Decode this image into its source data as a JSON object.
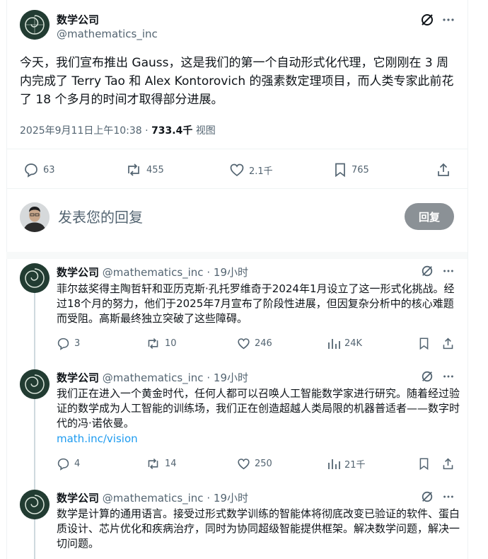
{
  "main_post": {
    "author_name": "数学公司",
    "handle": "@mathematics_inc",
    "text": "今天，我们宣布推出 Gauss，这是我们的第一个自动形式化代理，它刚刚在 3 周内完成了 Terry Tao 和 Alex Kontorovich 的强素数定理项目，而人类专家此前花了 18 个多月的时间才取得部分进展。",
    "timestamp": "2025年9月11日上午10:38 ·",
    "views_count": "733.4千",
    "views_label": "视图",
    "stats": {
      "replies": "63",
      "reposts": "455",
      "likes": "2.1千",
      "bookmarks": "765"
    }
  },
  "composer": {
    "placeholder": "发表您的回复",
    "button_label": "回复"
  },
  "replies": [
    {
      "author_name": "数学公司",
      "handle": "@mathematics_inc",
      "dot": "·",
      "time": "19小时",
      "text": "菲尔兹奖得主陶哲轩和亚历克斯·孔托罗维奇于2024年1月设立了这一形式化挑战。经过18个月的努力，他们于2025年7月宣布了阶段性进展，但因复杂分析中的核心难题而受阻。高斯最终独立突破了这些障碍。",
      "link": "",
      "stats": {
        "replies": "3",
        "reposts": "10",
        "likes": "246",
        "views": "24K"
      }
    },
    {
      "author_name": "数学公司",
      "handle": "@mathematics_inc",
      "dot": "·",
      "time": "19小时",
      "text": "我们正在进入一个黄金时代，任何人都可以召唤人工智能数学家进行研究。随着经过验证的数学成为人工智能的训练场，我们正在创造超越人类局限的机器普适者——数字时代的冯·诺依曼。",
      "link": "math.inc/vision",
      "stats": {
        "replies": "4",
        "reposts": "14",
        "likes": "250",
        "views": "21千"
      }
    },
    {
      "author_name": "数学公司",
      "handle": "@mathematics_inc",
      "dot": "·",
      "time": "19小时",
      "text": "数学是计算的通用语言。接受过形式数学训练的智能体将彻底改变已验证的软件、蛋白质设计、芯片优化和疾病治疗，同时为协同超级智能提供框架。解决数学问题，解决一切问题。",
      "link": ""
    }
  ],
  "icons": {
    "grok": "slashed-circle-icon",
    "more": "more-dots-icon",
    "reply": "speech-bubble-icon",
    "repost": "repost-arrows-icon",
    "like": "heart-icon",
    "bookmark": "bookmark-icon",
    "share": "share-upload-icon",
    "views": "bar-chart-icon"
  }
}
